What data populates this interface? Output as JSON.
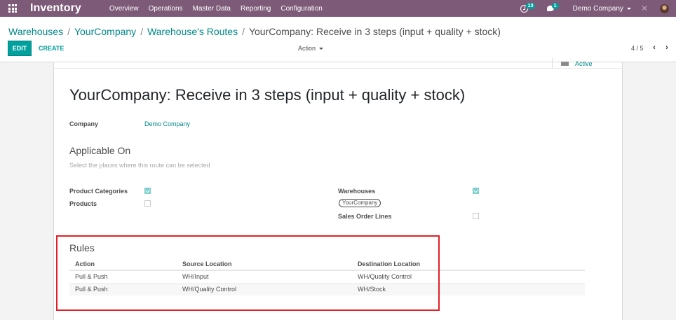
{
  "navbar": {
    "brand": "Inventory",
    "menu": [
      "Overview",
      "Operations",
      "Master Data",
      "Reporting",
      "Configuration"
    ],
    "activity_count": "10",
    "message_count": "1",
    "company": "Demo Company"
  },
  "breadcrumb": {
    "items": [
      "Warehouses",
      "YourCompany",
      "Warehouse's Routes"
    ],
    "current": "YourCompany: Receive in 3 steps (input + quality + stock)"
  },
  "toolbar": {
    "edit_label": "EDIT",
    "create_label": "CREATE",
    "action_label": "Action",
    "pager": "4 / 5"
  },
  "record": {
    "active_label": "Active",
    "title": "YourCompany: Receive in 3 steps (input + quality + stock)",
    "company_label": "Company",
    "company_value": "Demo Company",
    "applicable_title": "Applicable On",
    "applicable_help": "Select the places where this route can be selected",
    "product_categories_label": "Product Categories",
    "products_label": "Products",
    "warehouses_label": "Warehouses",
    "warehouse_tag": "YourCompany",
    "sales_order_lines_label": "Sales Order Lines",
    "checkboxes": {
      "product_categories": true,
      "products": false,
      "warehouses": true,
      "sales_order_lines": false
    }
  },
  "rules": {
    "title": "Rules",
    "columns": [
      "Action",
      "Source Location",
      "Destination Location"
    ],
    "rows": [
      [
        "Pull & Push",
        "WH/Input",
        "WH/Quality Control"
      ],
      [
        "Pull & Push",
        "WH/Quality Control",
        "WH/Stock"
      ]
    ]
  },
  "colors": {
    "navbar": "#7c5a78",
    "accent": "#00a09d",
    "link": "#00878a",
    "highlight": "#e11f26"
  }
}
